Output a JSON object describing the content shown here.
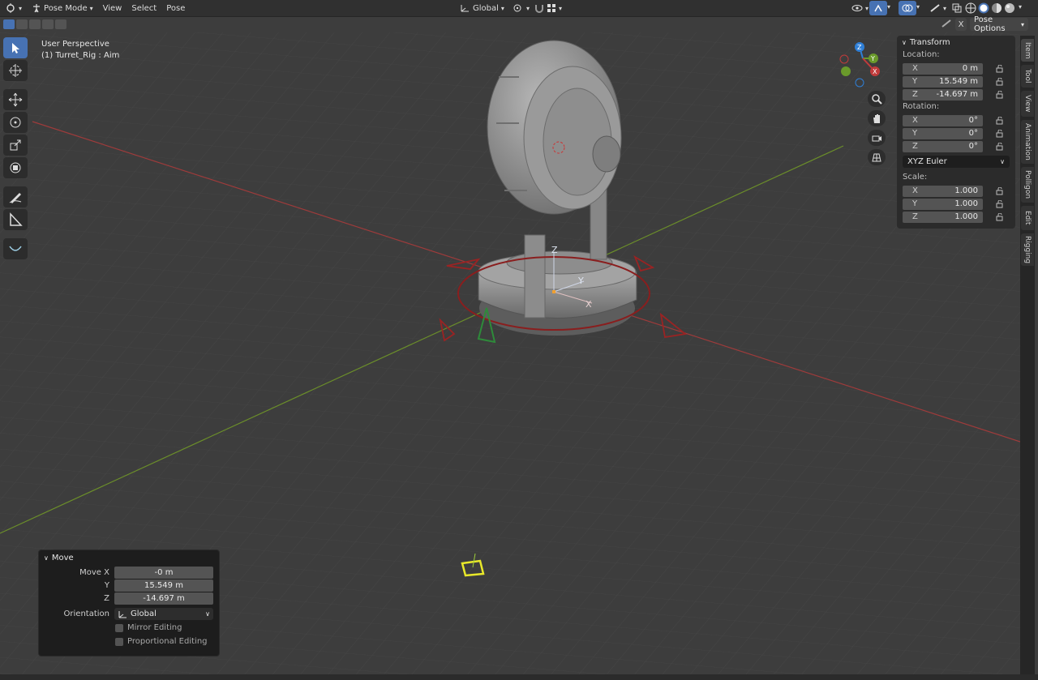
{
  "header": {
    "mode": "Pose Mode",
    "menus": [
      "View",
      "Select",
      "Pose"
    ],
    "orientation": "Global",
    "pose_options": "Pose Options",
    "xray_label": "X"
  },
  "viewport": {
    "view_name": "User Perspective",
    "object_info": "(1) Turret_Rig : Aim",
    "gizmo_axes": {
      "x": "X",
      "y": "Y",
      "z": "Z"
    }
  },
  "transform_panel": {
    "title": "Transform",
    "location_label": "Location:",
    "location": [
      {
        "axis": "X",
        "value": "0 m"
      },
      {
        "axis": "Y",
        "value": "15.549 m"
      },
      {
        "axis": "Z",
        "value": "-14.697 m"
      }
    ],
    "rotation_label": "Rotation:",
    "rotation": [
      {
        "axis": "X",
        "value": "0°"
      },
      {
        "axis": "Y",
        "value": "0°"
      },
      {
        "axis": "Z",
        "value": "0°"
      }
    ],
    "rotation_mode": "XYZ Euler",
    "scale_label": "Scale:",
    "scale": [
      {
        "axis": "X",
        "value": "1.000"
      },
      {
        "axis": "Y",
        "value": "1.000"
      },
      {
        "axis": "Z",
        "value": "1.000"
      }
    ]
  },
  "sidebar_tabs": [
    "Item",
    "Tool",
    "View",
    "Animation",
    "Polligon",
    "Edit",
    "Rigging"
  ],
  "redo_panel": {
    "title": "Move",
    "move_x_label": "Move X",
    "move_x": "-0 m",
    "y_label": "Y",
    "move_y": "15.549 m",
    "z_label": "Z",
    "move_z": "-14.697 m",
    "orientation_label": "Orientation",
    "orientation": "Global",
    "mirror_label": "Mirror Editing",
    "proportional_label": "Proportional Editing"
  },
  "colors": {
    "accent": "#4772b3",
    "x_axis": "#b33a3a",
    "y_axis": "#6a9a2b",
    "z_axis": "#2f7fd6",
    "ring": "#8a1e1e"
  }
}
